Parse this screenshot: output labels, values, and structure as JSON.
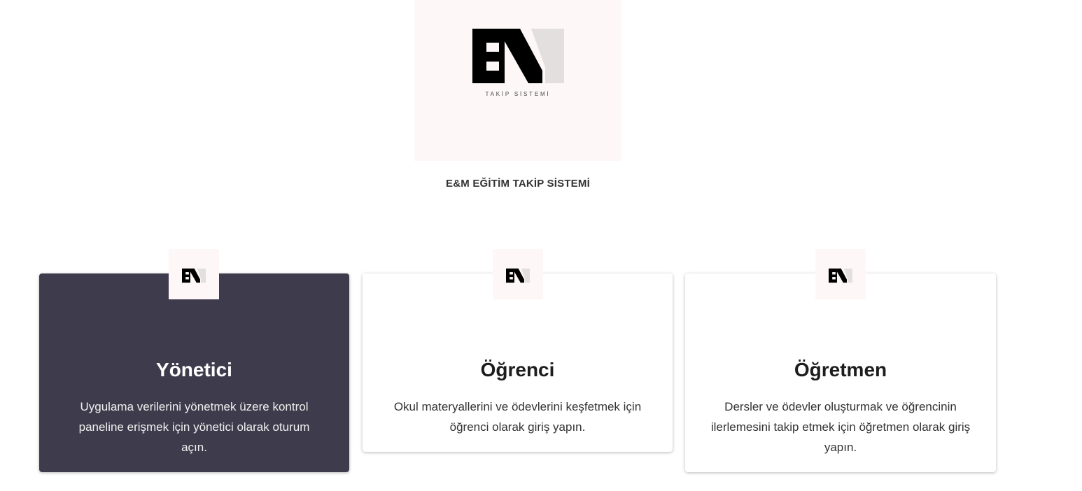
{
  "logo": {
    "tagline": "TAKİP SİSTEMİ"
  },
  "site_title": "E&M EĞİTİM TAKİP SİSTEMİ",
  "roles": [
    {
      "title": "Yönetici",
      "description": "Uygulama verilerini yönetmek üzere kontrol paneline erişmek için yönetici olarak oturum açın.",
      "selected": true
    },
    {
      "title": "Öğrenci",
      "description": "Okul materyallerini ve ödevlerini keşfetmek için öğrenci olarak giriş yapın.",
      "selected": false
    },
    {
      "title": "Öğretmen",
      "description": "Dersler ve ödevler oluşturmak ve öğrencinin ilerlemesini takip etmek için öğretmen olarak giriş yapın.",
      "selected": false
    }
  ],
  "colors": {
    "selected_card_bg": "#3e3c4c",
    "logo_bg": "#fdf8f7"
  }
}
